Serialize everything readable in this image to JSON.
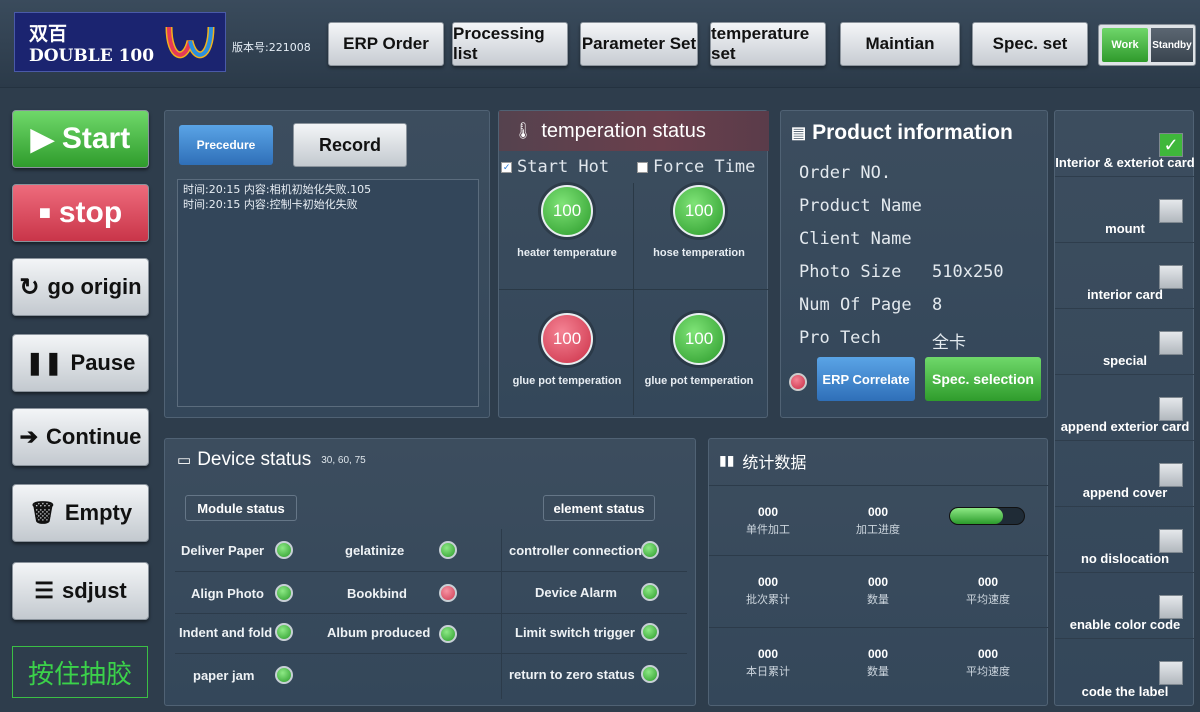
{
  "header": {
    "logo_zh": "双百",
    "logo_en": "DOUBLE 100",
    "version": "版本号:221008",
    "nav": [
      "ERP Order",
      "Processing list",
      "Parameter Set",
      "temperature set",
      "Maintian",
      "Spec. set"
    ],
    "mode_work": "Work",
    "mode_standby": "Standby"
  },
  "controls": {
    "start": "Start",
    "stop": "stop",
    "go_origin": "go origin",
    "pause": "Pause",
    "continue": "Continue",
    "empty": "Empty",
    "adjust": "sdjust",
    "hold_glue": "按住抽胶"
  },
  "log": {
    "procedure_label": "Precedure",
    "record_label": "Record",
    "lines": [
      "时间:20:15   内容:相机初始化失败.105",
      "时间:20:15   内容:控制卡初始化失败"
    ]
  },
  "temperature": {
    "title": "temperation status",
    "start_hot_label": "Start Hot",
    "start_hot_checked": true,
    "force_time_label": "Force Time",
    "force_time_checked": false,
    "gauges": [
      {
        "value": "100",
        "label": "heater temperature",
        "status": "green"
      },
      {
        "value": "100",
        "label": "hose temperation",
        "status": "green"
      },
      {
        "value": "100",
        "label": "glue pot temperation",
        "status": "red"
      },
      {
        "value": "100",
        "label": "glue pot temperation",
        "status": "green"
      }
    ]
  },
  "product": {
    "title": "Product information",
    "fields": [
      {
        "label": "Order NO.",
        "value": ""
      },
      {
        "label": "Product Name",
        "value": ""
      },
      {
        "label": "Client Name",
        "value": ""
      },
      {
        "label": "Photo Size",
        "value": "510x250"
      },
      {
        "label": "Num Of Page",
        "value": "8"
      },
      {
        "label": "Pro Tech",
        "value": "全卡"
      }
    ],
    "erp_correlate": "ERP Correlate",
    "spec_selection": "Spec. selection"
  },
  "device": {
    "title": "Device status",
    "coords": "30, 60, 75",
    "module_header": "Module status",
    "element_header": "element status",
    "module_items": [
      {
        "label": "Deliver Paper",
        "status": "green"
      },
      {
        "label": "gelatinize",
        "status": "green"
      },
      {
        "label": "Align Photo",
        "status": "green"
      },
      {
        "label": "Bookbind",
        "status": "red"
      },
      {
        "label": "Indent and fold",
        "status": "green"
      },
      {
        "label": "Album produced",
        "status": "green"
      },
      {
        "label": "paper jam",
        "status": "green"
      }
    ],
    "element_items": [
      {
        "label": "controller connection",
        "status": "green"
      },
      {
        "label": "Device Alarm",
        "status": "green"
      },
      {
        "label": "Limit switch trigger",
        "status": "green"
      },
      {
        "label": "return to zero status",
        "status": "green"
      }
    ]
  },
  "stats": {
    "title": "统计数据",
    "progress_fraction": 0.72,
    "cells": [
      {
        "value": "000",
        "label": "单件加工"
      },
      {
        "value": "000",
        "label": "加工进度"
      },
      {
        "value": "000",
        "label": "批次累计"
      },
      {
        "value": "000",
        "label": "数量"
      },
      {
        "value": "000",
        "label": "平均速度"
      },
      {
        "value": "000",
        "label": "本日累计"
      },
      {
        "value": "000",
        "label": "数量"
      },
      {
        "value": "000",
        "label": "平均速度"
      }
    ]
  },
  "options": [
    {
      "label": "Interior & exteriot card",
      "checked": true
    },
    {
      "label": "mount",
      "checked": false
    },
    {
      "label": "interior card",
      "checked": false
    },
    {
      "label": "special",
      "checked": false
    },
    {
      "label": "append exterior card",
      "checked": false
    },
    {
      "label": "append cover",
      "checked": false
    },
    {
      "label": "no dislocation",
      "checked": false
    },
    {
      "label": "enable color code",
      "checked": false
    },
    {
      "label": "code the label",
      "checked": false
    }
  ],
  "colors": {
    "green": "#3fb73b",
    "red": "#d0394f",
    "blue": "#2f6fb8",
    "background": "#2e3d4c"
  }
}
